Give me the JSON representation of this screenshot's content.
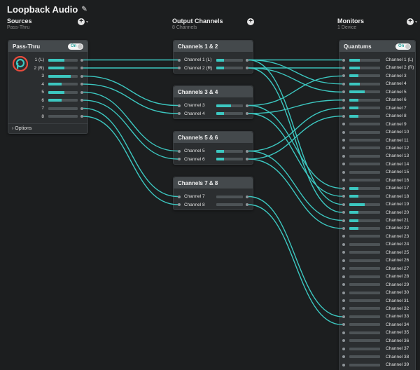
{
  "app": {
    "title": "Loopback Audio"
  },
  "columns": {
    "sources": {
      "title": "Sources",
      "subtitle": "Pass-Thru"
    },
    "output": {
      "title": "Output Channels",
      "subtitle": "8 Channels"
    },
    "monitors": {
      "title": "Monitors",
      "subtitle": "1 Device"
    }
  },
  "source_panel": {
    "name": "Pass-Thru",
    "toggle": "On",
    "options_label": "Options",
    "channels": [
      {
        "label": "1 (L)",
        "level": 0.55
      },
      {
        "label": "2 (R)",
        "level": 0.55
      },
      {
        "label": "3",
        "level": 0.75
      },
      {
        "label": "4",
        "level": 0.45
      },
      {
        "label": "5",
        "level": 0.55
      },
      {
        "label": "6",
        "level": 0.45
      },
      {
        "label": "7",
        "level": 0.0
      },
      {
        "label": "8",
        "level": 0.0
      }
    ]
  },
  "output_panels": [
    {
      "name": "Channels 1 & 2",
      "channels": [
        {
          "label": "Channel 1 (L)",
          "level": 0.3
        },
        {
          "label": "Channel 2 (R)",
          "level": 0.3
        }
      ]
    },
    {
      "name": "Channels 3 & 4",
      "channels": [
        {
          "label": "Channel 3",
          "level": 0.55
        },
        {
          "label": "Channel 4",
          "level": 0.3
        }
      ]
    },
    {
      "name": "Channels 5 & 6",
      "channels": [
        {
          "label": "Channel 5",
          "level": 0.3
        },
        {
          "label": "Channel 6",
          "level": 0.3
        }
      ]
    },
    {
      "name": "Channels 7 & 8",
      "channels": [
        {
          "label": "Channel 7",
          "level": 0.0
        },
        {
          "label": "Channel 8",
          "level": 0.0
        }
      ]
    }
  ],
  "monitor_panel": {
    "name": "Quantums",
    "toggle": "On",
    "channels": [
      {
        "label": "Channel 1 (L)",
        "level": 0.35
      },
      {
        "label": "Channel 2 (R)",
        "level": 0.35
      },
      {
        "label": "Channel 3",
        "level": 0.3
      },
      {
        "label": "Channel 4",
        "level": 0.35
      },
      {
        "label": "Channel 5",
        "level": 0.5
      },
      {
        "label": "Channel 6",
        "level": 0.3
      },
      {
        "label": "Channel 7",
        "level": 0.3
      },
      {
        "label": "Channel 8",
        "level": 0.3
      },
      {
        "label": "Channel 9",
        "level": 0.0
      },
      {
        "label": "Channel 10",
        "level": 0.0
      },
      {
        "label": "Channel 11",
        "level": 0.0
      },
      {
        "label": "Channel 12",
        "level": 0.0
      },
      {
        "label": "Channel 13",
        "level": 0.0
      },
      {
        "label": "Channel 14",
        "level": 0.0
      },
      {
        "label": "Channel 15",
        "level": 0.0
      },
      {
        "label": "Channel 16",
        "level": 0.0
      },
      {
        "label": "Channel 17",
        "level": 0.3
      },
      {
        "label": "Channel 18",
        "level": 0.3
      },
      {
        "label": "Channel 19",
        "level": 0.5
      },
      {
        "label": "Channel 20",
        "level": 0.3
      },
      {
        "label": "Channel 21",
        "level": 0.3
      },
      {
        "label": "Channel 22",
        "level": 0.3
      },
      {
        "label": "Channel 23",
        "level": 0.0
      },
      {
        "label": "Channel 24",
        "level": 0.0
      },
      {
        "label": "Channel 25",
        "level": 0.0
      },
      {
        "label": "Channel 26",
        "level": 0.0
      },
      {
        "label": "Channel 27",
        "level": 0.0
      },
      {
        "label": "Channel 28",
        "level": 0.0
      },
      {
        "label": "Channel 29",
        "level": 0.0
      },
      {
        "label": "Channel 30",
        "level": 0.0
      },
      {
        "label": "Channel 31",
        "level": 0.0
      },
      {
        "label": "Channel 32",
        "level": 0.0
      },
      {
        "label": "Channel 33",
        "level": 0.0
      },
      {
        "label": "Channel 34",
        "level": 0.0
      },
      {
        "label": "Channel 35",
        "level": 0.0
      },
      {
        "label": "Channel 36",
        "level": 0.0
      },
      {
        "label": "Channel 37",
        "level": 0.0
      },
      {
        "label": "Channel 38",
        "level": 0.0
      },
      {
        "label": "Channel 39",
        "level": 0.0
      }
    ]
  },
  "routes": {
    "source_to_output": [
      [
        1,
        1
      ],
      [
        2,
        2
      ],
      [
        3,
        3
      ],
      [
        4,
        4
      ],
      [
        5,
        5
      ],
      [
        6,
        6
      ],
      [
        7,
        7
      ],
      [
        8,
        8
      ]
    ],
    "output_to_monitor": [
      [
        1,
        1
      ],
      [
        1,
        4
      ],
      [
        1,
        19
      ],
      [
        2,
        2
      ],
      [
        2,
        5
      ],
      [
        2,
        20
      ],
      [
        3,
        3
      ],
      [
        3,
        17
      ],
      [
        4,
        6
      ],
      [
        4,
        18
      ],
      [
        5,
        7
      ],
      [
        5,
        21
      ],
      [
        6,
        8
      ],
      [
        6,
        22
      ],
      [
        7,
        33
      ],
      [
        8,
        34
      ]
    ]
  },
  "colors": {
    "wire": "#3cc7c0",
    "meter_fill": "#3cc7c0",
    "panel": "#2b2e30",
    "panel_head": "#44494c",
    "background": "#1c1e1f"
  },
  "icons": {
    "edit": "pencil-icon",
    "add": "plus-circle-icon",
    "expand": "chevron-right-icon"
  }
}
